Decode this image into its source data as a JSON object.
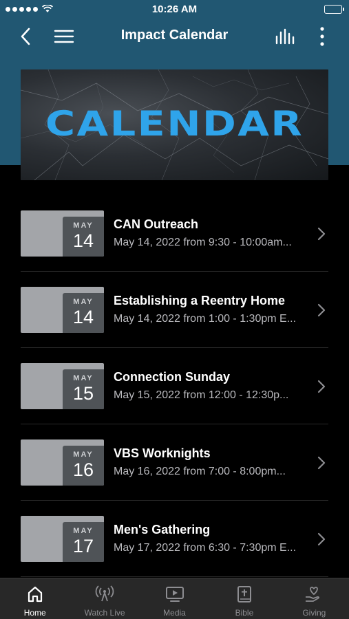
{
  "status_bar": {
    "time": "10:26 AM"
  },
  "nav": {
    "title": "Impact Calendar"
  },
  "banner": {
    "text": "CALENDAR",
    "color": "#2fa4ea"
  },
  "events": [
    {
      "month": "MAY",
      "day": "14",
      "title": "CAN Outreach",
      "subtitle": "May 14, 2022 from 9:30 - 10:00am..."
    },
    {
      "month": "MAY",
      "day": "14",
      "title": "Establishing a Reentry Home",
      "subtitle": "May 14, 2022 from 1:00 - 1:30pm E..."
    },
    {
      "month": "MAY",
      "day": "15",
      "title": "Connection Sunday",
      "subtitle": "May 15, 2022 from 12:00 - 12:30p..."
    },
    {
      "month": "MAY",
      "day": "16",
      "title": "VBS Worknights",
      "subtitle": "May 16, 2022 from 7:00 - 8:00pm..."
    },
    {
      "month": "MAY",
      "day": "17",
      "title": "Men's Gathering",
      "subtitle": "May 17, 2022 from 6:30 - 7:30pm E..."
    }
  ],
  "tabs": [
    {
      "label": "Home",
      "icon": "home-icon",
      "active": true
    },
    {
      "label": "Watch Live",
      "icon": "broadcast-icon",
      "active": false
    },
    {
      "label": "Media",
      "icon": "media-icon",
      "active": false
    },
    {
      "label": "Bible",
      "icon": "bible-icon",
      "active": false
    },
    {
      "label": "Giving",
      "icon": "giving-icon",
      "active": false
    }
  ],
  "colors": {
    "header": "#215772",
    "accent": "#2fa4ea",
    "background": "#000000",
    "tab_bar": "#282828"
  }
}
